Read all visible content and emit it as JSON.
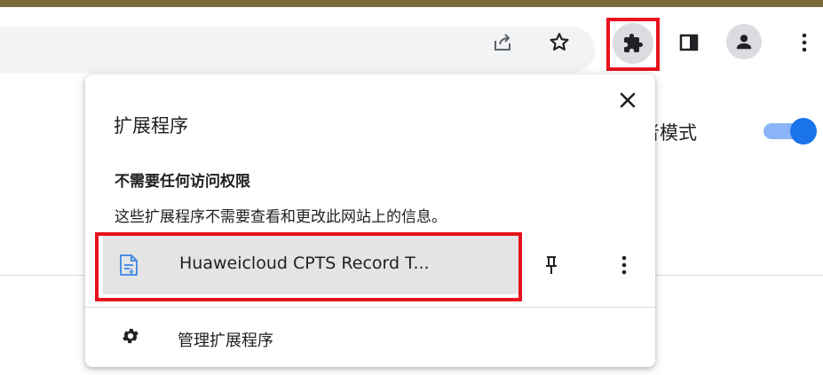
{
  "toolbar": {
    "icons": [
      "share-icon",
      "bookmark-star-icon",
      "extensions-puzzle-icon",
      "side-panel-icon",
      "profile-avatar-icon",
      "more-vertical-icon"
    ]
  },
  "page": {
    "partial_label": "者模式",
    "toggle_on": true
  },
  "popup": {
    "title": "扩展程序",
    "section_heading": "不需要任何访问权限",
    "section_description": "这些扩展程序不需要查看和更改此网站上的信息。",
    "extension": {
      "name": "Huaweicloud CPTS Record T..."
    },
    "manage_label": "管理扩展程序"
  },
  "colors": {
    "highlight": "#e8121c",
    "accent": "#1a73e8"
  }
}
